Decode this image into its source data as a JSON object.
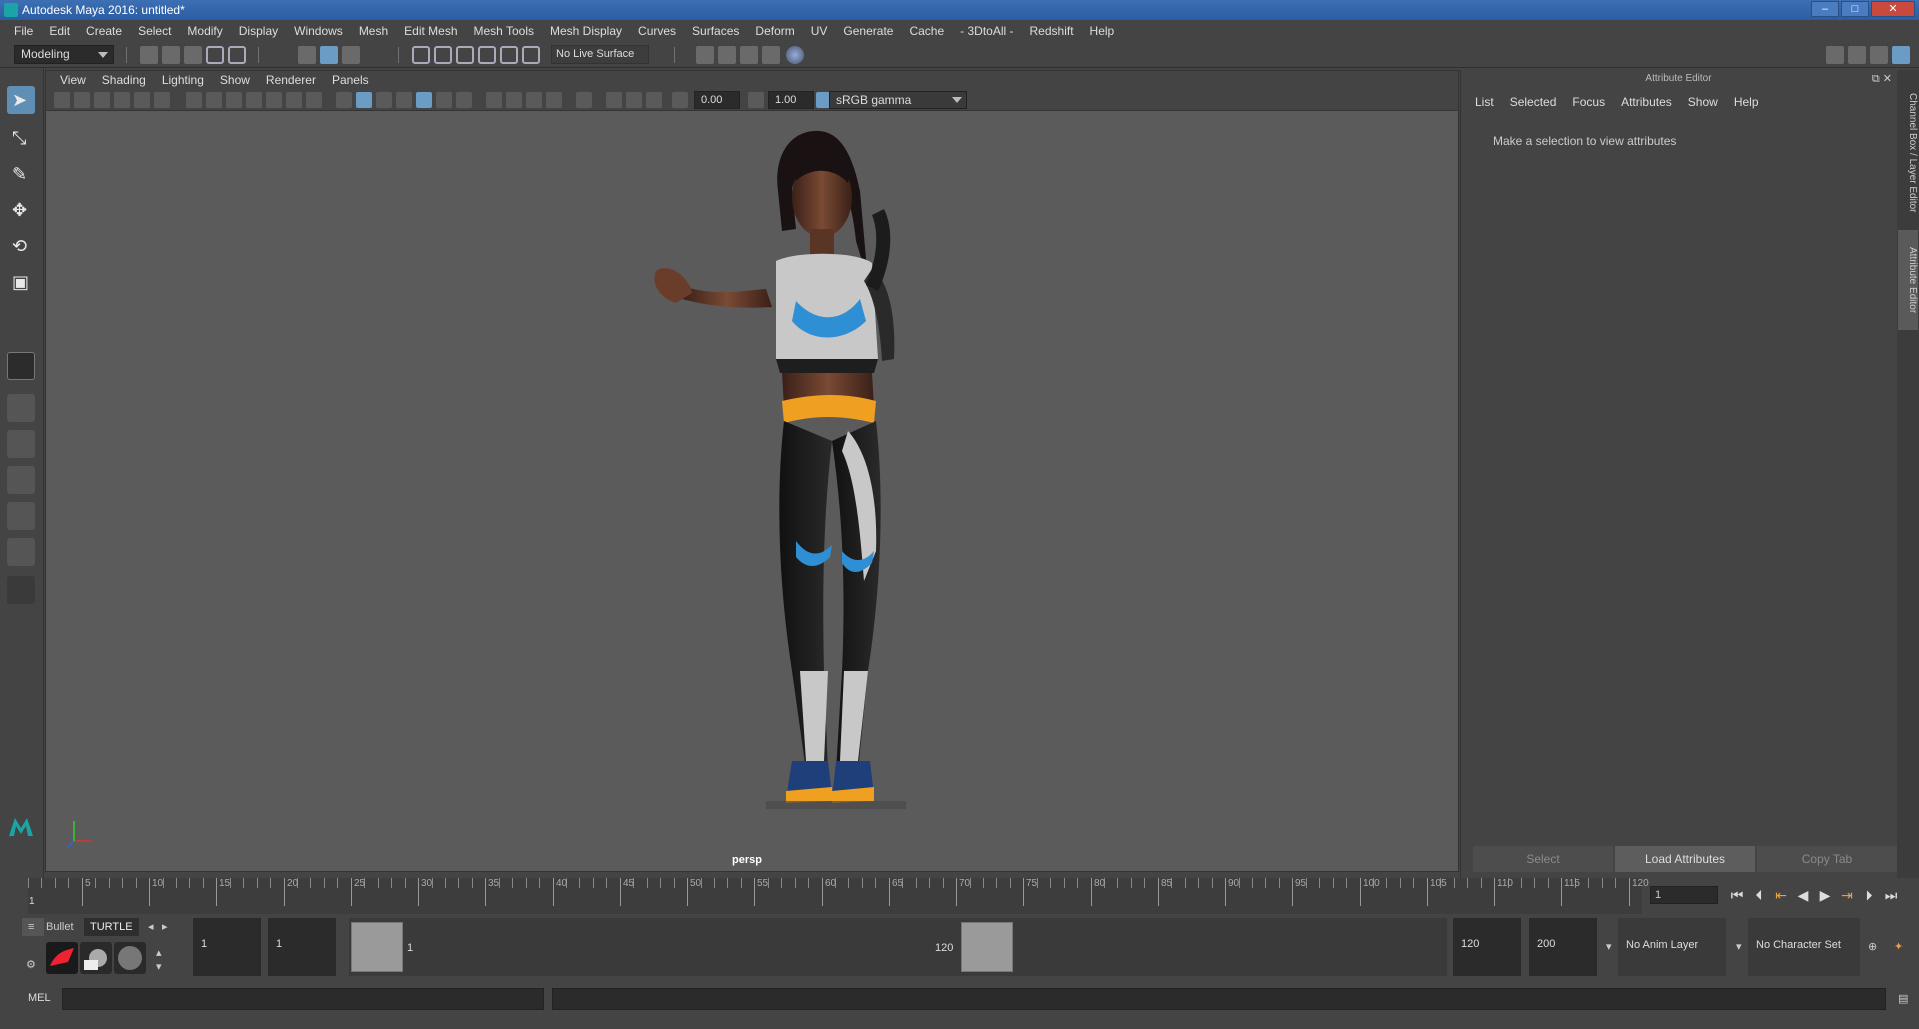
{
  "window": {
    "title": "Autodesk Maya 2016: untitled*"
  },
  "menubar": [
    "File",
    "Edit",
    "Create",
    "Select",
    "Modify",
    "Display",
    "Windows",
    "Mesh",
    "Edit Mesh",
    "Mesh Tools",
    "Mesh Display",
    "Curves",
    "Surfaces",
    "Deform",
    "UV",
    "Generate",
    "Cache",
    "- 3DtoAll -",
    "Redshift",
    "Help"
  ],
  "statusline": {
    "mode": "Modeling",
    "live_surface": "No Live Surface"
  },
  "viewport": {
    "menu": [
      "View",
      "Shading",
      "Lighting",
      "Show",
      "Renderer",
      "Panels"
    ],
    "exposure": "0.00",
    "gamma": "1.00",
    "color_space": "sRGB gamma",
    "camera_label": "persp"
  },
  "attribute_editor": {
    "title": "Attribute Editor",
    "menu": [
      "List",
      "Selected",
      "Focus",
      "Attributes",
      "Show",
      "Help"
    ],
    "message": "Make a selection to view attributes",
    "buttons": {
      "select": "Select",
      "load": "Load Attributes",
      "copy": "Copy Tab"
    }
  },
  "side_tabs": {
    "channel_box": "Channel Box / Layer Editor",
    "attribute_editor": "Attribute Editor"
  },
  "timeslider": {
    "labels": [
      "5",
      "10",
      "15",
      "20",
      "25",
      "30",
      "35",
      "40",
      "45",
      "50",
      "55",
      "60",
      "65",
      "70",
      "75",
      "80",
      "85",
      "90",
      "95",
      "100",
      "105",
      "110",
      "115",
      "120"
    ],
    "start_label": "1",
    "current_frame": "1"
  },
  "rangeslider": {
    "shelf_tabs": {
      "bullet": "Bullet",
      "turtle": "TURTLE"
    },
    "start_time": "1",
    "playback_start": "1",
    "range_start_label": "1",
    "range_end_label": "120",
    "playback_end": "120",
    "end_time": "200",
    "anim_layer": "No Anim Layer",
    "character_set": "No Character Set"
  },
  "commandline": {
    "label": "MEL"
  }
}
